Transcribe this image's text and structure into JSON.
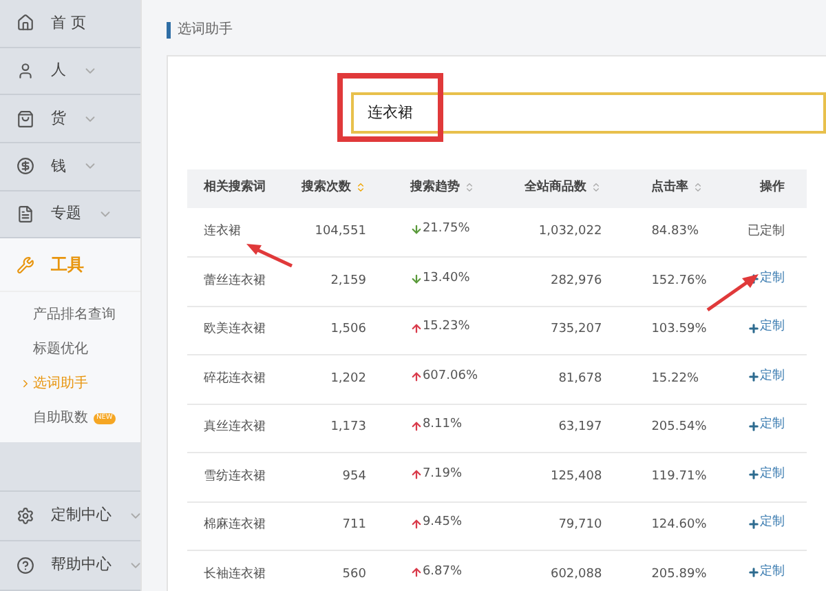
{
  "sidebar": {
    "items": [
      {
        "label": "首 页",
        "expandable": false
      },
      {
        "label": "人",
        "expandable": true
      },
      {
        "label": "货",
        "expandable": true
      },
      {
        "label": "钱",
        "expandable": true
      },
      {
        "label": "专题",
        "expandable": true
      }
    ],
    "active_section": {
      "label": "工具",
      "children": [
        {
          "label": "产品排名查询",
          "selected": false
        },
        {
          "label": "标题优化",
          "selected": false
        },
        {
          "label": "选词助手",
          "selected": true
        },
        {
          "label": "自助取数",
          "selected": false,
          "badge": "NEW"
        }
      ]
    },
    "bottom_items": [
      {
        "label": "定制中心",
        "expandable": true
      },
      {
        "label": "帮助中心",
        "expandable": true
      }
    ]
  },
  "page_title": "选词助手",
  "search": {
    "value": "连衣裙"
  },
  "table": {
    "columns": [
      {
        "label": "相关搜索词",
        "sortable": false
      },
      {
        "label": "搜索次数",
        "sortable": true,
        "sorted": true
      },
      {
        "label": "搜索趋势",
        "sortable": true,
        "sorted": false
      },
      {
        "label": "全站商品数",
        "sortable": true,
        "sorted": false
      },
      {
        "label": "点击率",
        "sortable": true,
        "sorted": false
      },
      {
        "label": "操作",
        "sortable": false
      }
    ],
    "rows": [
      {
        "term": "连衣裙",
        "searches": "104,551",
        "trend": "21.75%",
        "rising": false,
        "products": "1,032,022",
        "ctr": "84.83%",
        "action": {
          "kind": "done",
          "label": "已定制"
        }
      },
      {
        "term": "蕾丝连衣裙",
        "searches": "2,159",
        "trend": "13.40%",
        "rising": false,
        "products": "282,976",
        "ctr": "152.76%",
        "action": {
          "kind": "add",
          "label": "定制"
        }
      },
      {
        "term": "欧美连衣裙",
        "searches": "1,506",
        "trend": "15.23%",
        "rising": true,
        "products": "735,207",
        "ctr": "103.59%",
        "action": {
          "kind": "add",
          "label": "定制"
        }
      },
      {
        "term": "碎花连衣裙",
        "searches": "1,202",
        "trend": "607.06%",
        "rising": true,
        "products": "81,678",
        "ctr": "15.22%",
        "action": {
          "kind": "add",
          "label": "定制"
        }
      },
      {
        "term": "真丝连衣裙",
        "searches": "1,173",
        "trend": "8.11%",
        "rising": true,
        "products": "63,197",
        "ctr": "205.54%",
        "action": {
          "kind": "add",
          "label": "定制"
        }
      },
      {
        "term": "雪纺连衣裙",
        "searches": "954",
        "trend": "7.19%",
        "rising": true,
        "products": "125,408",
        "ctr": "119.71%",
        "action": {
          "kind": "add",
          "label": "定制"
        }
      },
      {
        "term": "棉麻连衣裙",
        "searches": "711",
        "trend": "9.45%",
        "rising": true,
        "products": "79,710",
        "ctr": "124.60%",
        "action": {
          "kind": "add",
          "label": "定制"
        }
      },
      {
        "term": "长袖连衣裙",
        "searches": "560",
        "trend": "6.87%",
        "rising": true,
        "products": "602,088",
        "ctr": "205.89%",
        "action": {
          "kind": "add",
          "label": "定制"
        }
      }
    ]
  }
}
